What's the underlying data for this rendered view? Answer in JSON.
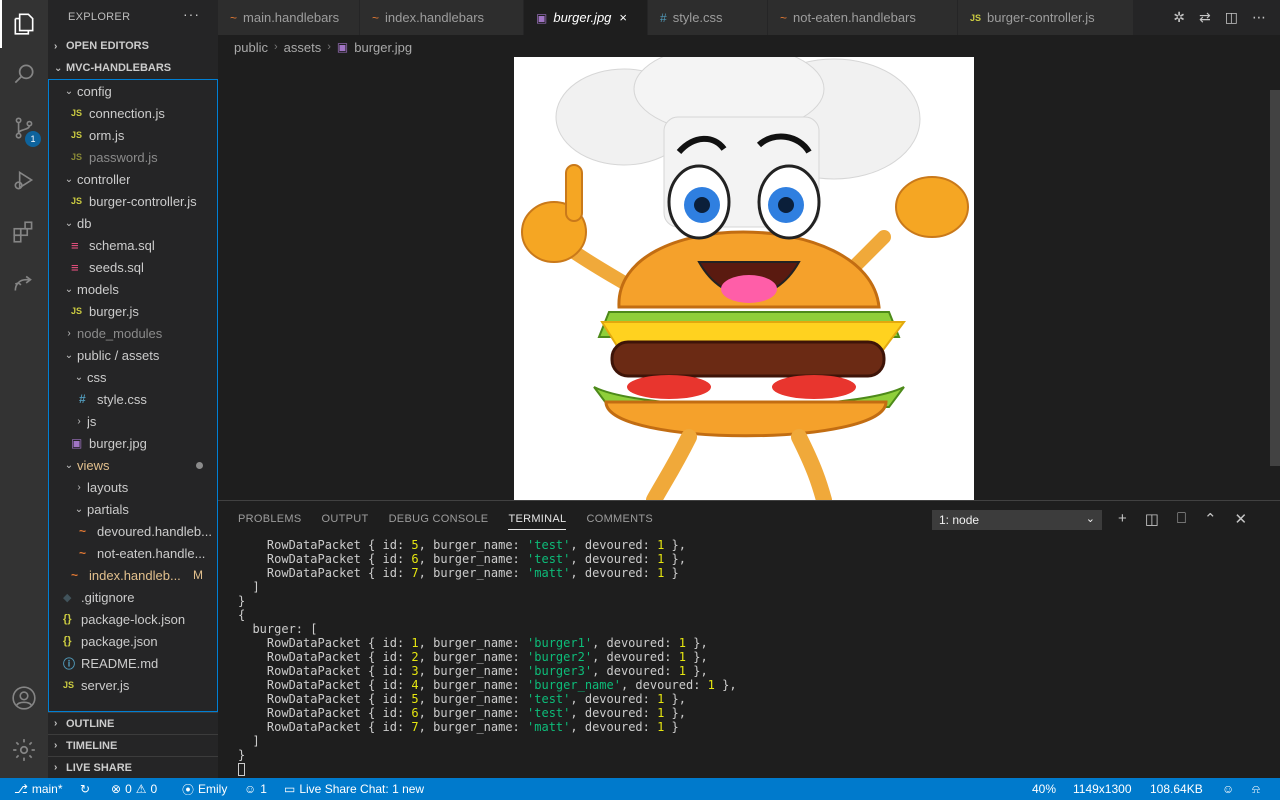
{
  "sidebar": {
    "title": "EXPLORER",
    "more": "···",
    "open_editors": "OPEN EDITORS",
    "project": "MVC-HANDLEBARS",
    "tree": [
      {
        "label": "config",
        "twist": "⌄",
        "icon": "",
        "type": "folder"
      },
      {
        "label": "connection.js",
        "icon": "JS",
        "type": "js"
      },
      {
        "label": "orm.js",
        "icon": "JS",
        "type": "js"
      },
      {
        "label": "password.js",
        "icon": "JS",
        "type": "js"
      },
      {
        "label": "controller",
        "twist": "⌄",
        "icon": "",
        "type": "folder"
      },
      {
        "label": "burger-controller.js",
        "icon": "JS",
        "type": "js"
      },
      {
        "label": "db",
        "twist": "⌄",
        "icon": "",
        "type": "folder"
      },
      {
        "label": "schema.sql",
        "icon": "≡",
        "type": "sql"
      },
      {
        "label": "seeds.sql",
        "icon": "≡",
        "type": "sql"
      },
      {
        "label": "models",
        "twist": "⌄",
        "icon": "",
        "type": "folder"
      },
      {
        "label": "burger.js",
        "icon": "JS",
        "type": "js"
      },
      {
        "label": "node_modules",
        "twist": "›",
        "icon": "",
        "type": "folder"
      },
      {
        "label": "public / assets",
        "twist": "⌄",
        "icon": "",
        "type": "folder"
      },
      {
        "label": "css",
        "twist": "⌄",
        "icon": "",
        "type": "folder"
      },
      {
        "label": "style.css",
        "icon": "#",
        "type": "css"
      },
      {
        "label": "js",
        "twist": "›",
        "icon": "",
        "type": "folder"
      },
      {
        "label": "burger.jpg",
        "icon": "▣",
        "type": "img"
      },
      {
        "label": "views",
        "twist": "⌄",
        "icon": "",
        "type": "folder"
      },
      {
        "label": "layouts",
        "twist": "›",
        "icon": "",
        "type": "folder"
      },
      {
        "label": "partials",
        "twist": "⌄",
        "icon": "",
        "type": "folder"
      },
      {
        "label": "devoured.handleb...",
        "icon": "~",
        "type": "hb"
      },
      {
        "label": "not-eaten.handle...",
        "icon": "~",
        "type": "hb"
      },
      {
        "label": "index.handleb...",
        "icon": "~",
        "type": "hb"
      },
      {
        "label": ".gitignore",
        "icon": "◆",
        "type": "git"
      },
      {
        "label": "package-lock.json",
        "icon": "{}",
        "type": "json"
      },
      {
        "label": "package.json",
        "icon": "{}",
        "type": "json"
      },
      {
        "label": "README.md",
        "icon": "ⓘ",
        "type": "md"
      },
      {
        "label": "server.js",
        "icon": "JS",
        "type": "js"
      }
    ],
    "modified_flag": "M",
    "outline": "OUTLINE",
    "timeline": "TIMELINE",
    "live_share": "LIVE SHARE"
  },
  "activity": {
    "scm_badge": "1"
  },
  "tabs": [
    {
      "label": "main.handlebars",
      "icon": "~"
    },
    {
      "label": "index.handlebars",
      "icon": "~"
    },
    {
      "label": "burger.jpg",
      "icon": "▣",
      "close": "×"
    },
    {
      "label": "style.css",
      "icon": "#"
    },
    {
      "label": "not-eaten.handlebars",
      "icon": "~"
    },
    {
      "label": "burger-controller.js",
      "icon": "JS"
    }
  ],
  "breadcrumb": {
    "part1": "public",
    "part2": "assets",
    "part3": "burger.jpg",
    "sep": "›"
  },
  "panel": {
    "tabs": [
      "PROBLEMS",
      "OUTPUT",
      "DEBUG CONSOLE",
      "TERMINAL",
      "COMMENTS"
    ],
    "terminal_select": "1: node",
    "dropdown": "⌄",
    "actions": {
      "add": "+",
      "split": "◫",
      "trash": "⎕",
      "maximize": "⌃",
      "close": "✕"
    }
  },
  "terminal": {
    "rows_top": [
      {
        "id": "5",
        "name": "test",
        "devoured": "1"
      },
      {
        "id": "6",
        "name": "test",
        "devoured": "1"
      },
      {
        "id": "7",
        "name": "matt",
        "devoured": "1"
      }
    ],
    "rows_burger": [
      {
        "id": "1",
        "name": "burger1",
        "devoured": "1"
      },
      {
        "id": "2",
        "name": "burger2",
        "devoured": "1"
      },
      {
        "id": "3",
        "name": "burger3",
        "devoured": "1"
      },
      {
        "id": "4",
        "name": "burger_name",
        "devoured": "1"
      },
      {
        "id": "5",
        "name": "test",
        "devoured": "1"
      },
      {
        "id": "6",
        "name": "test",
        "devoured": "1"
      },
      {
        "id": "7",
        "name": "matt",
        "devoured": "1"
      }
    ],
    "packet": "RowDataPacket",
    "burger_key": "burger: ["
  },
  "status": {
    "branch": "main*",
    "errors": "0",
    "warnings": "0",
    "user": "Emily",
    "share_count": "1",
    "live_share_chat": "Live Share Chat: 1 new",
    "zoom": "40%",
    "dimensions": "1149x1300",
    "filesize": "108.64KB"
  },
  "colors": {
    "accent": "#007acc",
    "focus_border": "#007fd4",
    "js": "#cbcb41",
    "string": "#0dbc79",
    "number": "#e5e510"
  }
}
